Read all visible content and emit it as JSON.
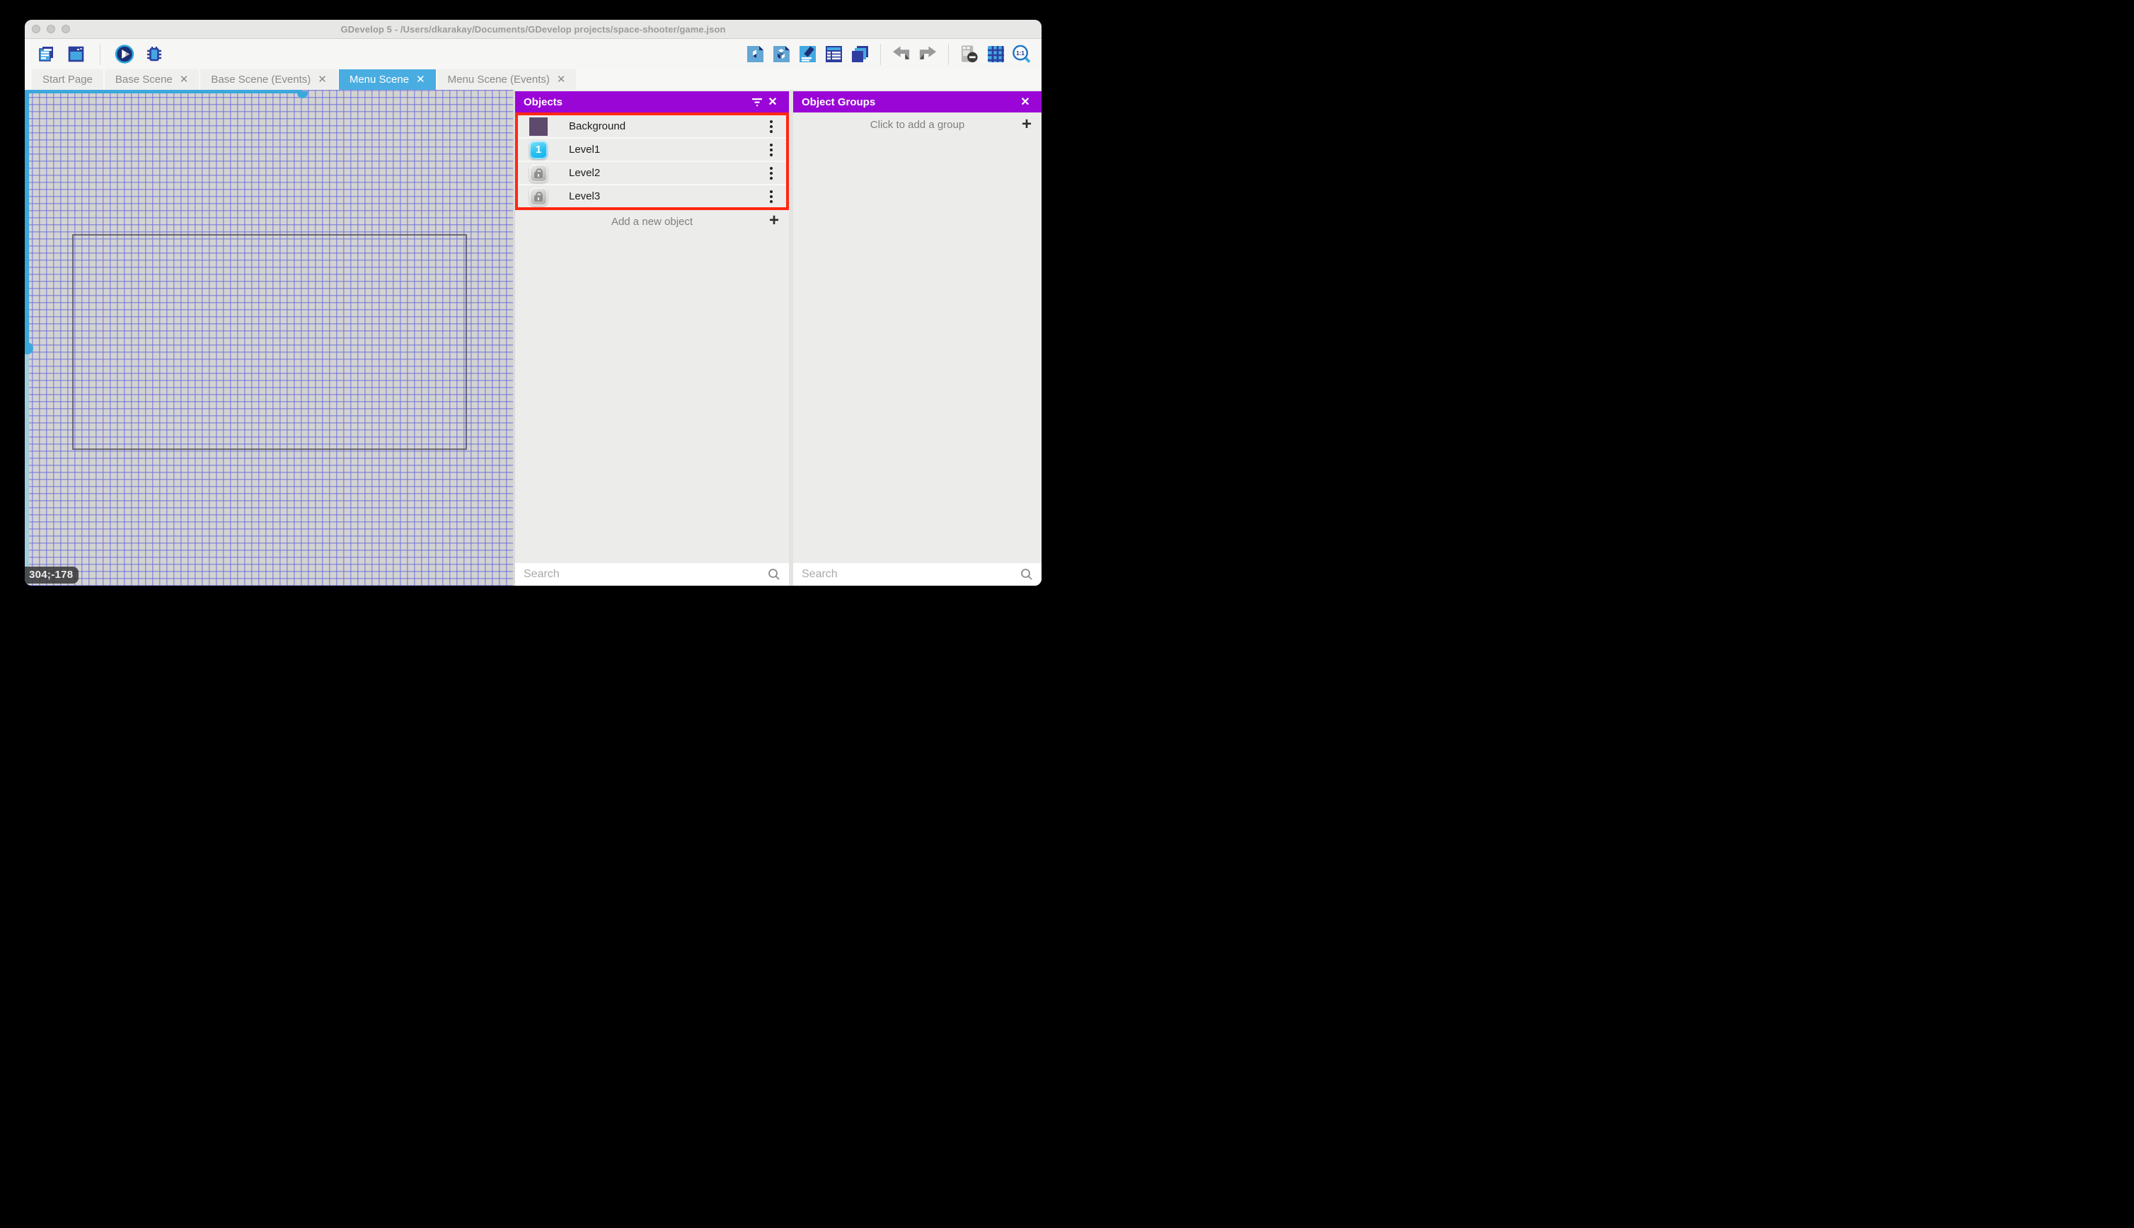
{
  "window": {
    "title": "GDevelop 5 - /Users/dkarakay/Documents/GDevelop projects/space-shooter/game.json"
  },
  "toolbar": {
    "left_icons": [
      "project-manager-icon",
      "scene-window-icon",
      "launch-preview-icon",
      "launch-debugger-icon"
    ],
    "right_icons": [
      "open-objects-panel-icon",
      "open-object-groups-panel-icon",
      "open-properties-panel-icon",
      "open-instances-list-icon",
      "open-layers-panel-icon",
      "undo-icon",
      "redo-icon",
      "toggle-instances-mask-icon",
      "toggle-grid-icon",
      "zoom-original-icon"
    ]
  },
  "tabs": [
    {
      "label": "Start Page",
      "closable": false,
      "active": false
    },
    {
      "label": "Base Scene",
      "closable": true,
      "active": false
    },
    {
      "label": "Base Scene (Events)",
      "closable": true,
      "active": false
    },
    {
      "label": "Menu Scene",
      "closable": true,
      "active": true
    },
    {
      "label": "Menu Scene (Events)",
      "closable": true,
      "active": false
    }
  ],
  "icons": {
    "close_glyph": "✕",
    "plus_glyph": "+"
  },
  "objects_panel": {
    "title": "Objects",
    "header_icons": [
      "filter-icon",
      "close-icon"
    ],
    "items": [
      {
        "name": "Background",
        "thumb": "purple-square-thumbnail",
        "thumb_text": ""
      },
      {
        "name": "Level1",
        "thumb": "level-one-button-thumbnail",
        "thumb_text": "1"
      },
      {
        "name": "Level2",
        "thumb": "locked-button-thumbnail",
        "thumb_text": ""
      },
      {
        "name": "Level3",
        "thumb": "locked-button-thumbnail",
        "thumb_text": ""
      }
    ],
    "add_label": "Add a new object",
    "search_placeholder": "Search"
  },
  "object_groups_panel": {
    "title": "Object Groups",
    "header_icons": [
      "close-icon"
    ],
    "add_label": "Click to add a group",
    "search_placeholder": "Search"
  },
  "canvas": {
    "coordinates": "304;-178"
  },
  "colors": {
    "panel_header_purple": "#9a06d6",
    "highlight_red": "#ff2713",
    "active_tab_blue": "#4aade2",
    "selection_blue": "#3ba8dd",
    "grid_line": "#6567db",
    "canvas_bg": "#d3d3d2"
  }
}
